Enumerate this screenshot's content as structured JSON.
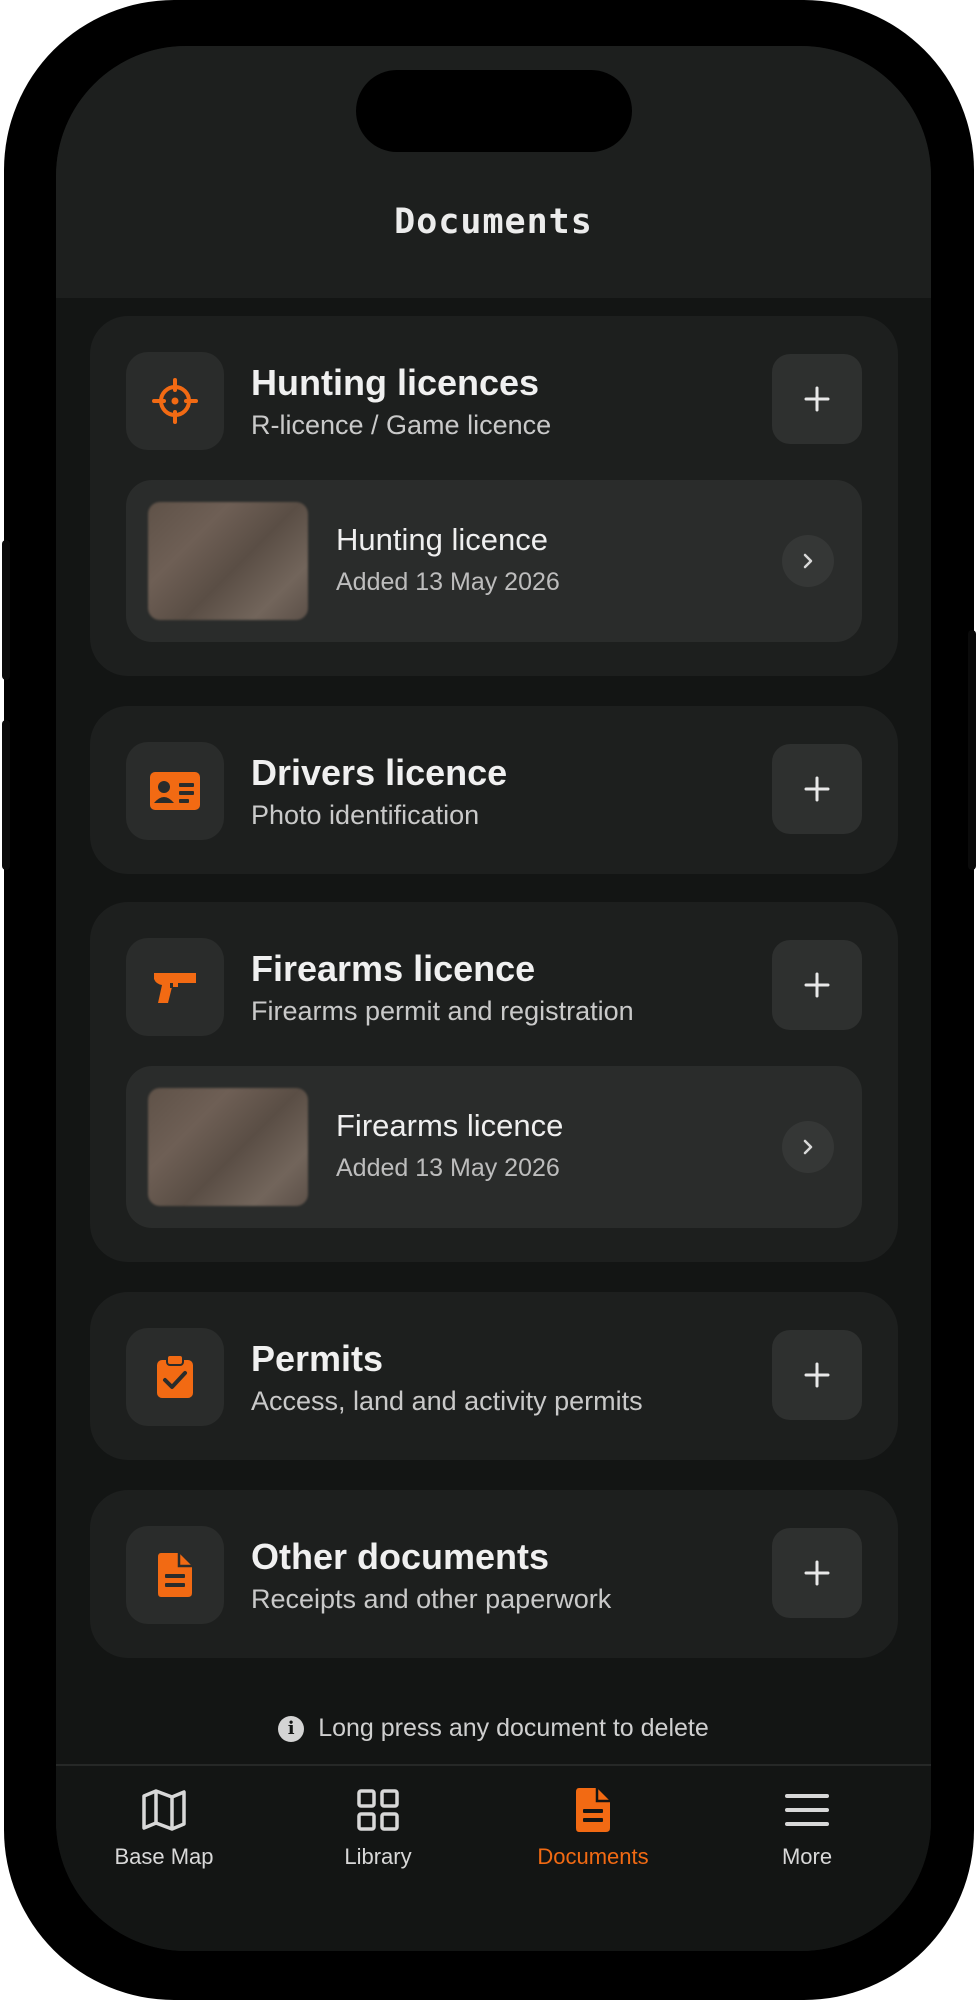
{
  "colors": {
    "accent": "#f26a13",
    "background": "#131514",
    "card": "#1d1f1e",
    "item": "#2a2c2b"
  },
  "header": {
    "title": "Documents"
  },
  "categories": [
    {
      "title": "Hunting licences",
      "subtitle": "R-licence / Game licence",
      "icon": "crosshair-icon",
      "add_label": "+",
      "items": [
        {
          "name": "Hunting licence",
          "date": "Added 13 May 2026"
        }
      ]
    },
    {
      "title": "Drivers licence",
      "subtitle": "Photo identification",
      "icon": "id-card-icon",
      "add_label": "+",
      "items": []
    },
    {
      "title": "Firearms licence",
      "subtitle": "Firearms permit and registration",
      "icon": "pistol-icon",
      "add_label": "+",
      "items": [
        {
          "name": "Firearms licence",
          "date": "Added 13 May 2026"
        }
      ]
    },
    {
      "title": "Permits",
      "subtitle": "Access, land and activity permits",
      "icon": "clipboard-check-icon",
      "add_label": "+",
      "items": []
    },
    {
      "title": "Other documents",
      "subtitle": "Receipts and other paperwork",
      "icon": "document-icon",
      "add_label": "+",
      "items": []
    }
  ],
  "hint": {
    "icon": "info-icon",
    "text": "Long press any document to delete"
  },
  "tabs": [
    {
      "label": "Base Map",
      "icon": "map-icon",
      "active": false
    },
    {
      "label": "Library",
      "icon": "grid-icon",
      "active": false
    },
    {
      "label": "Documents",
      "icon": "document-icon",
      "active": true
    },
    {
      "label": "More",
      "icon": "menu-icon",
      "active": false
    }
  ]
}
